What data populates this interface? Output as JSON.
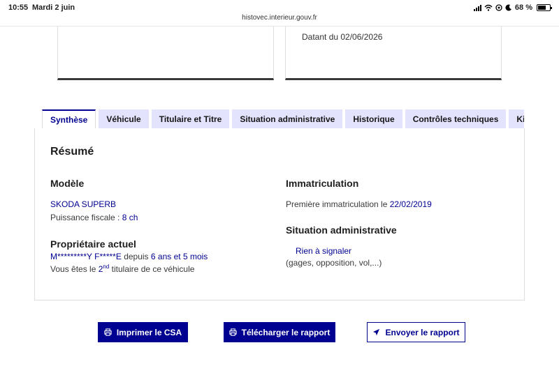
{
  "status_bar": {
    "time": "10:55",
    "date": "Mardi 2 juin",
    "battery": "68 %",
    "battery_level": 0.68
  },
  "browser": {
    "url": "histovec.interieur.gouv.fr"
  },
  "card_right": {
    "date_text": "Datant du 02/06/2026"
  },
  "tabs": [
    {
      "label": "Synthèse",
      "active": true
    },
    {
      "label": "Véhicule",
      "active": false
    },
    {
      "label": "Titulaire et Titre",
      "active": false
    },
    {
      "label": "Situation administrative",
      "active": false
    },
    {
      "label": "Historique",
      "active": false
    },
    {
      "label": "Contrôles techniques",
      "active": false
    },
    {
      "label": "Kilométrage",
      "active": false
    }
  ],
  "summary": {
    "title": "Résumé",
    "modele": {
      "heading": "Modèle",
      "name": "SKODA SUPERB",
      "puissance_label": "Puissance fiscale :",
      "puissance_value": "8 ch"
    },
    "proprietaire": {
      "heading": "Propriétaire actuel",
      "name": "M*********Y F*****E",
      "since_label": "depuis",
      "since_value": "6 ans et 5 mois",
      "rank_prefix": "Vous êtes le",
      "rank_number": "2",
      "rank_suffix": "nd",
      "rank_rest": "titulaire de ce véhicule"
    },
    "immatriculation": {
      "heading": "Immatriculation",
      "label": "Première immatriculation le",
      "date": "22/02/2019"
    },
    "situation": {
      "heading": "Situation administrative",
      "status": "Rien à signaler",
      "note": "(gages, opposition, vol,...)"
    }
  },
  "actions": {
    "print": "Imprimer le CSA",
    "download": "Télécharger le rapport",
    "send": "Envoyer le rapport"
  },
  "colors": {
    "primary": "#000091",
    "tab_bg": "#e3e3fd"
  }
}
